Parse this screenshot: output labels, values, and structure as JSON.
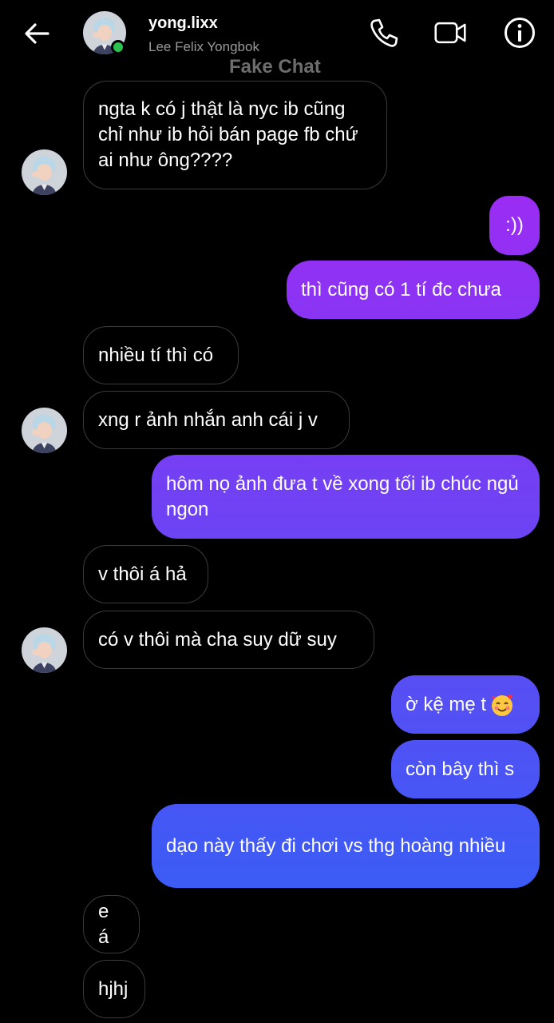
{
  "header": {
    "username": "yong.lixx",
    "fullname": "Lee Felix Yongbok",
    "watermark": "Fake Chat",
    "icons": [
      "back-arrow-icon",
      "phone-icon",
      "video-camera-icon",
      "info-icon"
    ]
  },
  "colors": {
    "online": "#2dc24e",
    "outgoing_top": "#9b2cf3",
    "outgoing_bottom": "#3b5cf5"
  },
  "messages": [
    {
      "side": "in",
      "text": "ngta k có j thật là nyc ib cũng chỉ như ib hỏi bán page fb chứ ai như ông????"
    },
    {
      "side": "out",
      "text": ":))"
    },
    {
      "side": "out",
      "text": "thì cũng có 1 tí đc chưa"
    },
    {
      "side": "in",
      "text": "nhiều tí thì có"
    },
    {
      "side": "in",
      "text": "xng r ảnh nhắn anh cái j v"
    },
    {
      "side": "out",
      "text": "hôm nọ ảnh đưa t về xong tối ib chúc ngủ ngon"
    },
    {
      "side": "in",
      "text": "v thôi á hả"
    },
    {
      "side": "in",
      "text": "có v thôi mà cha suy dữ suy"
    },
    {
      "side": "out",
      "text": "ờ kệ mẹ t",
      "emoji": "smiling-face-with-hearts-icon"
    },
    {
      "side": "out",
      "text": "còn bây thì s"
    },
    {
      "side": "out",
      "text": "dạo này thấy đi chơi vs thg hoàng nhiều"
    },
    {
      "side": "in",
      "text": "e á"
    },
    {
      "side": "in",
      "text": "hjhj"
    }
  ]
}
